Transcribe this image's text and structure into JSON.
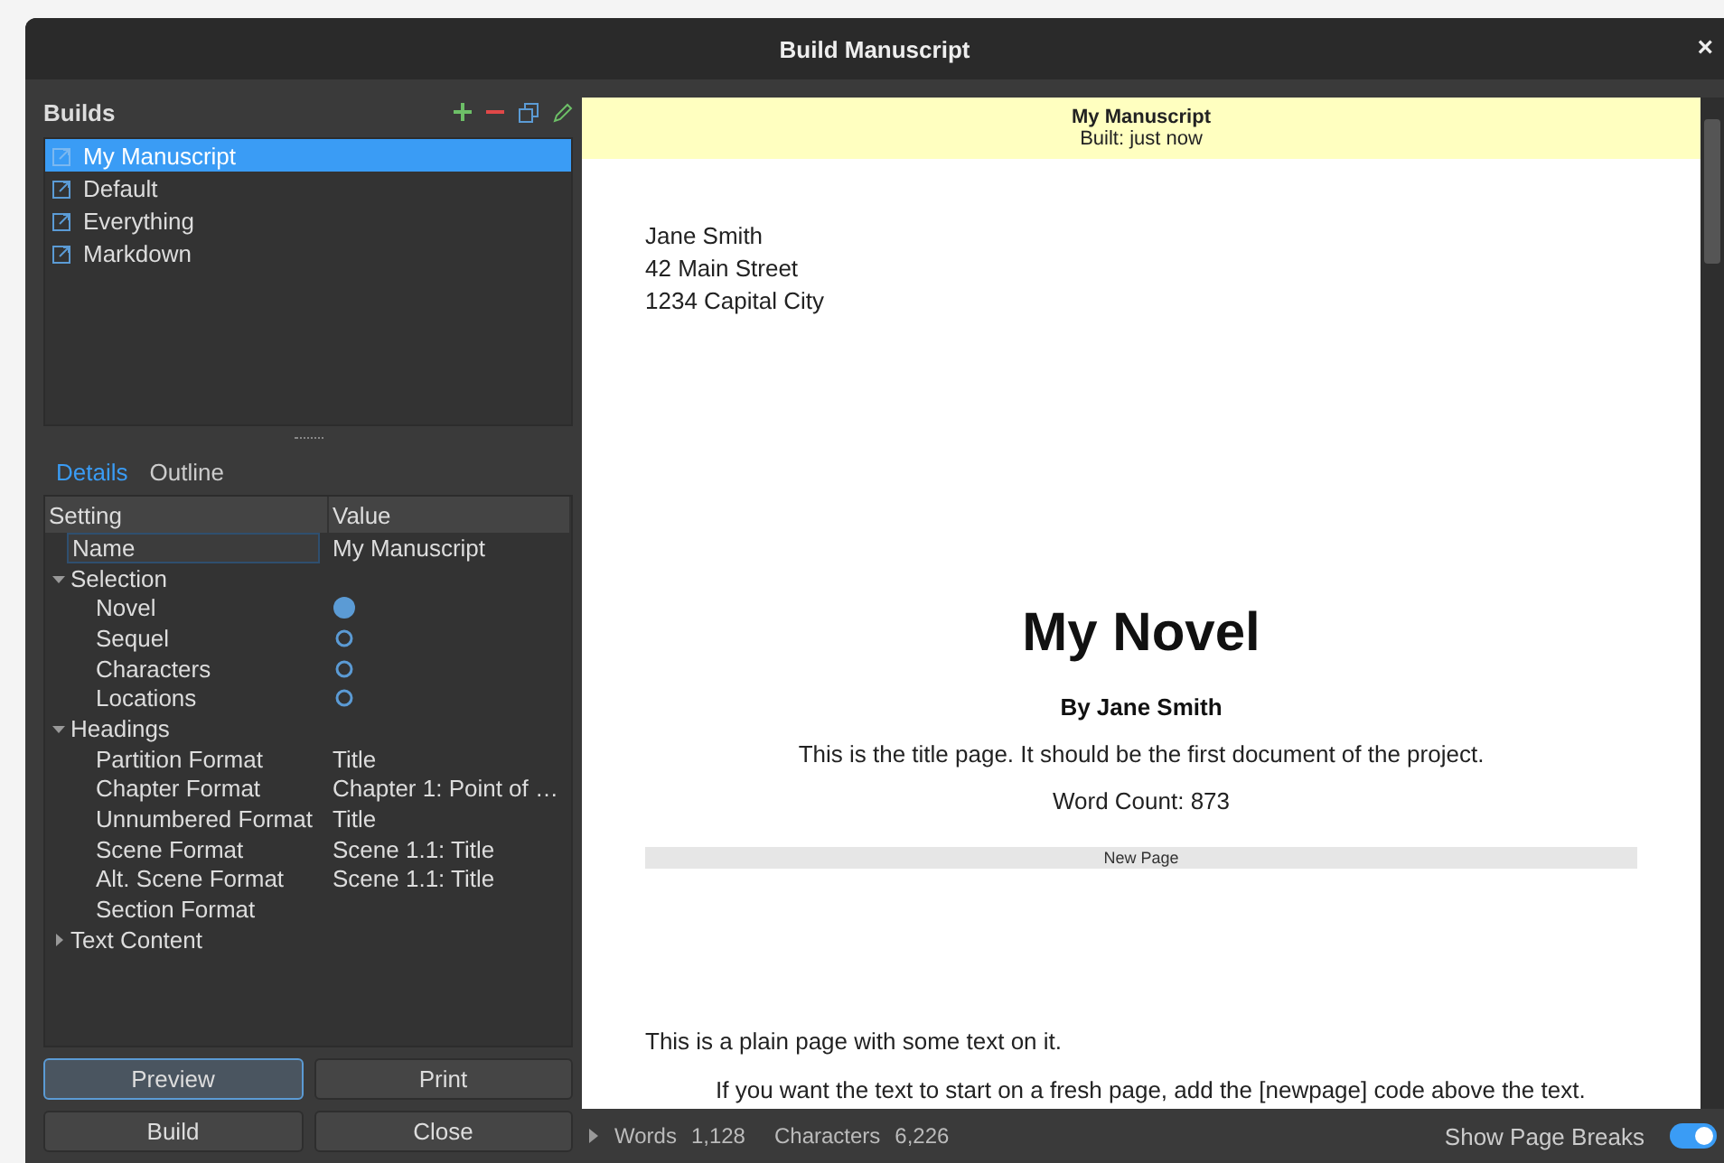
{
  "window": {
    "title": "Build Manuscript",
    "close": "×"
  },
  "builds": {
    "title": "Builds",
    "items": [
      {
        "label": "My Manuscript",
        "selected": true
      },
      {
        "label": "Default",
        "selected": false
      },
      {
        "label": "Everything",
        "selected": false
      },
      {
        "label": "Markdown",
        "selected": false
      }
    ]
  },
  "tabs": [
    {
      "label": "Details",
      "selected": true
    },
    {
      "label": "Outline",
      "selected": false
    }
  ],
  "settings": {
    "columns": [
      "Setting",
      "Value"
    ],
    "rows": [
      {
        "kind": "field",
        "label": "Name",
        "value": "My Manuscript"
      },
      {
        "kind": "group",
        "label": "Selection",
        "expanded": true,
        "children": [
          {
            "kind": "radio",
            "label": "Novel",
            "selected": true
          },
          {
            "kind": "radio",
            "label": "Sequel",
            "selected": false
          },
          {
            "kind": "radio",
            "label": "Characters",
            "selected": false
          },
          {
            "kind": "radio",
            "label": "Locations",
            "selected": false
          }
        ]
      },
      {
        "kind": "group",
        "label": "Headings",
        "expanded": true,
        "children": [
          {
            "kind": "value",
            "label": "Partition Format",
            "value": "Title"
          },
          {
            "kind": "value",
            "label": "Chapter Format",
            "value": "Chapter 1: Point of …"
          },
          {
            "kind": "value",
            "label": "Unnumbered Format",
            "value": "Title"
          },
          {
            "kind": "value",
            "label": "Scene Format",
            "value": "Scene 1.1: Title"
          },
          {
            "kind": "value",
            "label": "Alt. Scene Format",
            "value": "Scene 1.1: Title"
          },
          {
            "kind": "value",
            "label": "Section Format"
          }
        ]
      },
      {
        "kind": "group",
        "label": "Text Content",
        "expanded": false,
        "children": []
      }
    ]
  },
  "buttons": [
    {
      "label": "Preview",
      "focused": true
    },
    {
      "label": "Print",
      "focused": false
    },
    {
      "label": "Build",
      "focused": false
    },
    {
      "label": "Close",
      "focused": false
    }
  ],
  "preview": {
    "header_title": "My Manuscript",
    "header_subtitle": "Built: just now",
    "blocks": [
      {
        "kind": "address",
        "lines": [
          "Jane Smith",
          "42 Main Street",
          "1234 Capital City"
        ]
      },
      {
        "kind": "title",
        "text": "My Novel"
      },
      {
        "kind": "byline",
        "text": "By Jane Smith"
      },
      {
        "kind": "center",
        "text": "This is the title page. It should be the first document of the project."
      },
      {
        "kind": "center",
        "text": "Word Count: 873"
      },
      {
        "kind": "pagebreak",
        "text": "New Page"
      },
      {
        "kind": "para",
        "text": "This is a plain page with some text on it."
      },
      {
        "kind": "indent",
        "text": "If you want the text to start on a fresh page, add the [newpage] code above the text."
      }
    ]
  },
  "status_bar": {
    "words_label": "Words",
    "words": "1,128",
    "chars_label": "Characters",
    "chars": "6,226",
    "toggle_label": "Show Page Breaks",
    "toggle_on": true
  }
}
